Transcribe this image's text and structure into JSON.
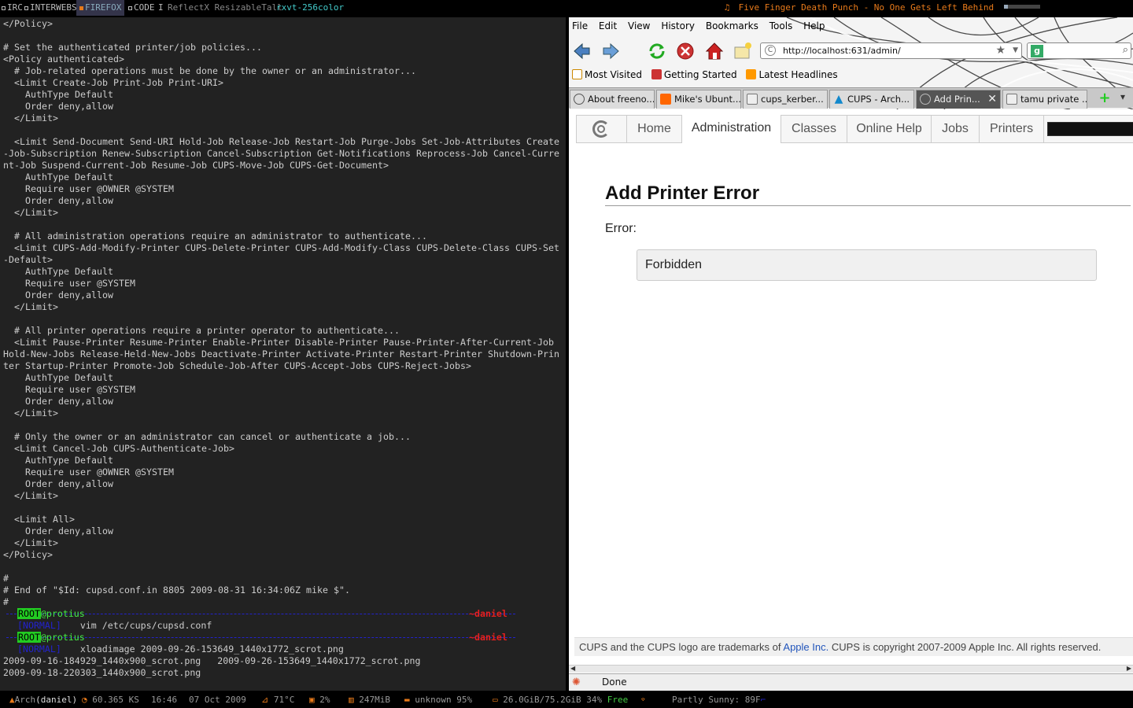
{
  "topbar": {
    "tags": [
      "IRC",
      "INTERWEBS",
      "FIREFOX",
      "CODE"
    ],
    "separator": "I",
    "window_flags": "ReflectX ResizableTall",
    "window_name": "rxvt-256color",
    "now_playing": "Five Finger Death Punch - No One Gets Left Behind",
    "progress": 0.12
  },
  "terminal": {
    "code": "</Policy>\n\n# Set the authenticated printer/job policies...\n<Policy authenticated>\n  # Job-related operations must be done by the owner or an administrator...\n  <Limit Create-Job Print-Job Print-URI>\n    AuthType Default\n    Order deny,allow\n  </Limit>\n\n  <Limit Send-Document Send-URI Hold-Job Release-Job Restart-Job Purge-Jobs Set-Job-Attributes Create-Job-Subscription Renew-Subscription Cancel-Subscription Get-Notifications Reprocess-Job Cancel-Current-Job Suspend-Current-Job Resume-Job CUPS-Move-Job CUPS-Get-Document>\n    AuthType Default\n    Require user @OWNER @SYSTEM\n    Order deny,allow\n  </Limit>\n\n  # All administration operations require an administrator to authenticate...\n  <Limit CUPS-Add-Modify-Printer CUPS-Delete-Printer CUPS-Add-Modify-Class CUPS-Delete-Class CUPS-Set-Default>\n    AuthType Default\n    Require user @SYSTEM\n    Order deny,allow\n  </Limit>\n\n  # All printer operations require a printer operator to authenticate...\n  <Limit Pause-Printer Resume-Printer Enable-Printer Disable-Printer Pause-Printer-After-Current-Job Hold-New-Jobs Release-Held-New-Jobs Deactivate-Printer Activate-Printer Restart-Printer Shutdown-Printer Startup-Printer Promote-Job Schedule-Job-After CUPS-Accept-Jobs CUPS-Reject-Jobs>\n    AuthType Default\n    Require user @SYSTEM\n    Order deny,allow\n  </Limit>\n\n  # Only the owner or an administrator can cancel or authenticate a job...\n  <Limit Cancel-Job CUPS-Authenticate-Job>\n    AuthType Default\n    Require user @OWNER @SYSTEM\n    Order deny,allow\n  </Limit>\n\n  <Limit All>\n    Order deny,allow\n  </Limit>\n</Policy>\n\n#\n# End of \"$Id: cupsd.conf.in 8805 2009-08-31 16:34:06Z mike $\".\n#",
    "prompt_user": "ROOT",
    "prompt_host": "@protius",
    "prompt_dir": "~daniel",
    "mode_label": "[NORMAL]",
    "cmd1": "vim /etc/cups/cupsd.conf",
    "cmd2": "xloadimage 2009-09-26-153649_1440x1772_scrot.png",
    "output": [
      "2009-09-16-184929_1440x900_scrot.png   2009-09-26-153649_1440x1772_scrot.png",
      "2009-09-18-220303_1440x900_scrot.png"
    ]
  },
  "firefox": {
    "menu": [
      "File",
      "Edit",
      "View",
      "History",
      "Bookmarks",
      "Tools",
      "Help"
    ],
    "url": "http://localhost:631/admin/",
    "bookmarks": [
      "Most Visited",
      "Getting Started",
      "Latest Headlines"
    ],
    "tabs": [
      "About freeno...",
      "Mike's Ubunt...",
      "cups_kerber...",
      "CUPS - Arch...",
      "Add Prin...",
      "tamu private ..."
    ],
    "status": "Done"
  },
  "cups": {
    "nav": [
      "Home",
      "Administration",
      "Classes",
      "Online Help",
      "Jobs",
      "Printers"
    ],
    "heading": "Add Printer Error",
    "error_label": "Error:",
    "error_message": "Forbidden",
    "footer_pre": "CUPS and the CUPS logo are trademarks of ",
    "footer_link": "Apple Inc.",
    "footer_post": " CUPS is copyright 2007-2009 Apple Inc. All rights reserved."
  },
  "bottombar": {
    "os": "Arch",
    "user": "(daniel)",
    "ks": "60.365 KS",
    "time": "16:46",
    "date": "07 Oct 2009",
    "temp": "71°C",
    "cpu": "2%",
    "mem": "247MiB",
    "battery": "unknown 95%",
    "disk": "26.0GiB/75.2GiB 34%",
    "disk_free": "Free",
    "weather": "Partly Sunny: 89F"
  },
  "colors": {
    "accent": "#e87a1a",
    "prompt_green": "#22cc22",
    "dir_red": "#e62020",
    "dash_blue": "#2222cc"
  }
}
